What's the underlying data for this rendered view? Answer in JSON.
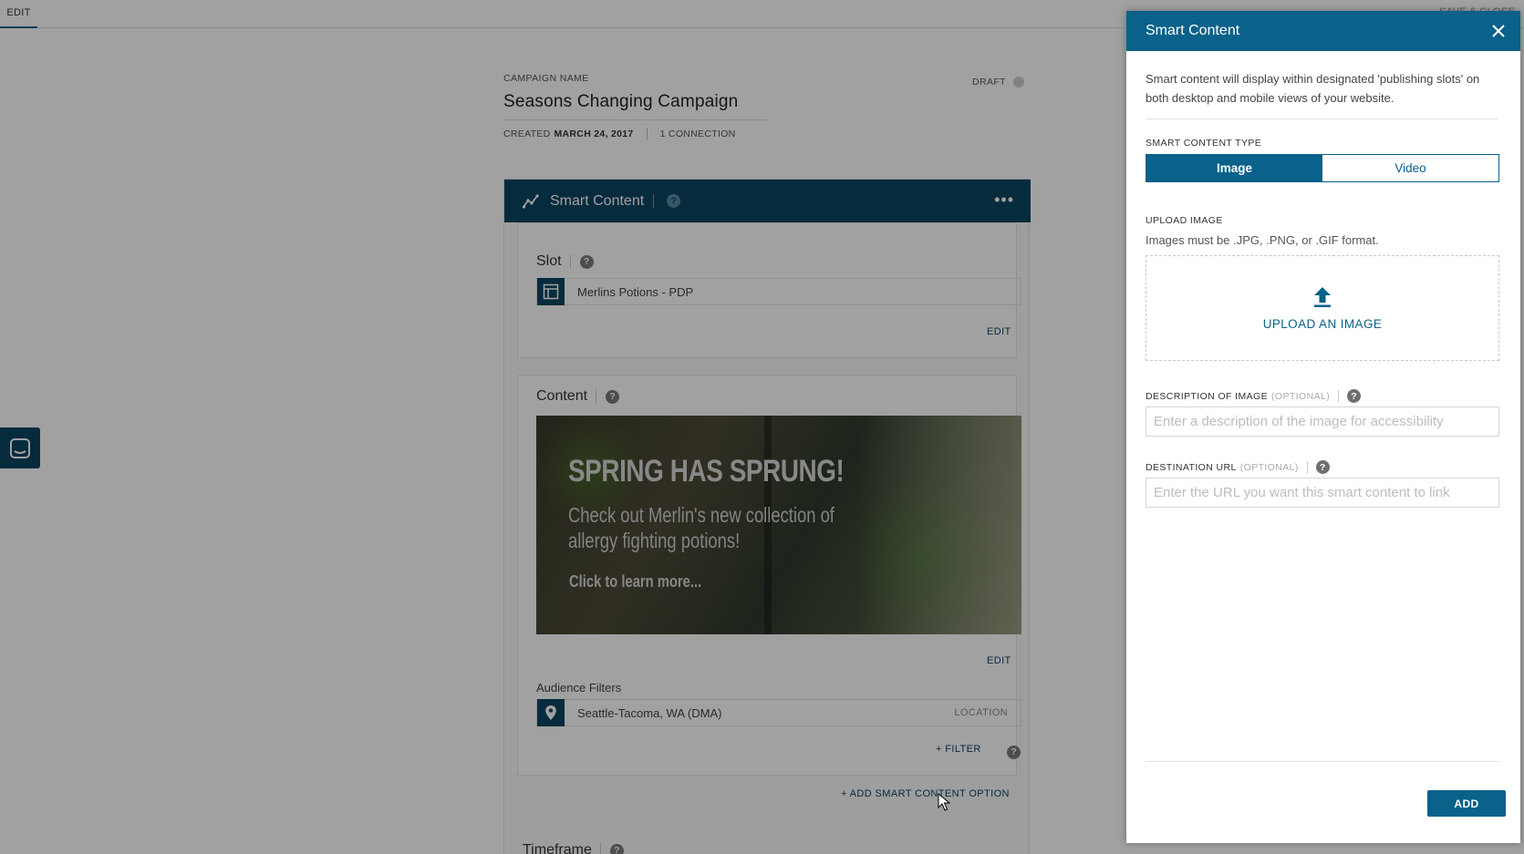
{
  "topbar": {
    "edit_tab": "EDIT",
    "right_text": "SAVE & CLOSE"
  },
  "campaign": {
    "name_label": "CAMPAIGN NAME",
    "name": "Seasons Changing Campaign",
    "created_label": "CREATED",
    "created_date": "MARCH 24, 2017",
    "connections": "1 CONNECTION",
    "status": "DRAFT"
  },
  "card": {
    "title": "Smart Content",
    "menu": "•••",
    "slot": {
      "title": "Slot",
      "value": "Merlins Potions - PDP",
      "edit": "EDIT"
    },
    "content": {
      "title": "Content",
      "banner_headline": "SPRING HAS SPRUNG!",
      "banner_sub": "Check out Merlin's new collection of allergy fighting potions!",
      "banner_cta": "Click to learn more...",
      "edit": "EDIT",
      "audience_label": "Audience Filters",
      "audience_value": "Seattle-Tacoma, WA (DMA)",
      "audience_type": "LOCATION",
      "filter_link": "+ FILTER"
    },
    "add_option": "+ ADD SMART CONTENT OPTION",
    "timeframe": "Timeframe"
  },
  "panel": {
    "title": "Smart Content",
    "intro": "Smart content will display within designated 'publishing slots' on both desktop and mobile views of your website.",
    "type_label": "SMART CONTENT TYPE",
    "type_options": [
      "Image",
      "Video"
    ],
    "upload_label": "UPLOAD IMAGE",
    "upload_help": "Images must be .JPG, .PNG, or .GIF format.",
    "upload_cta": "UPLOAD AN IMAGE",
    "description_label": "DESCRIPTION OF IMAGE",
    "description_optional": "(OPTIONAL)",
    "description_placeholder": "Enter a description of the image for accessibility",
    "url_label": "DESTINATION URL",
    "url_optional": "(OPTIONAL)",
    "url_placeholder": "Enter the URL you want this smart content to link",
    "add_button": "ADD"
  },
  "colors": {
    "accent": "#0a6189",
    "header_dark": "#0b4561"
  }
}
